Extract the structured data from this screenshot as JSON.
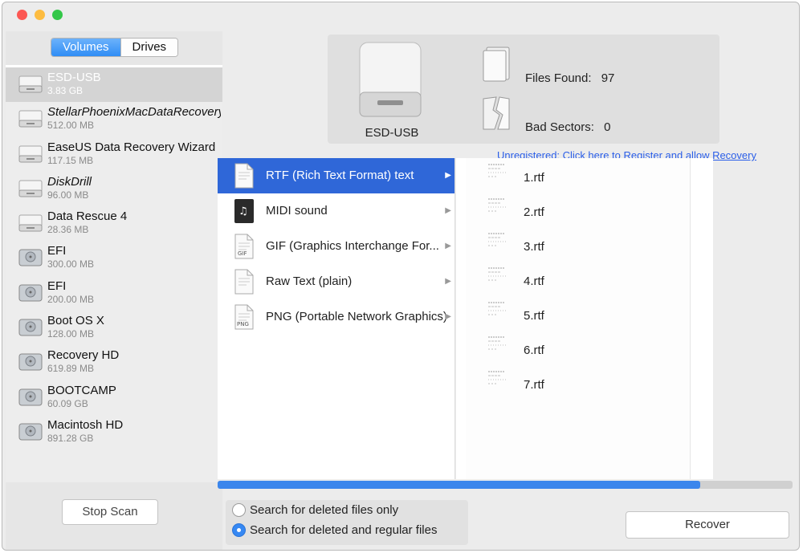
{
  "window": {
    "colors": {
      "close": "#fc5753",
      "minimize": "#fdbc40",
      "zoom": "#33c748",
      "accent": "#2f67d8",
      "link": "#2a5ee8"
    }
  },
  "sidebar": {
    "tabs": [
      {
        "label": "Volumes",
        "active": true
      },
      {
        "label": "Drives",
        "active": false
      }
    ],
    "volumes": [
      {
        "name": "ESD-USB",
        "size": "3.83 GB",
        "icon": "usb-drive-icon",
        "italic": false,
        "selected": true
      },
      {
        "name": "StellarPhoenixMacDataRecovery",
        "size": "512.00 MB",
        "icon": "disk-image-icon",
        "italic": true,
        "selected": false
      },
      {
        "name": "EaseUS Data Recovery Wizard",
        "size": "117.15 MB",
        "icon": "disk-image-icon",
        "italic": false,
        "selected": false
      },
      {
        "name": "DiskDrill",
        "size": "96.00 MB",
        "icon": "disk-image-icon",
        "italic": true,
        "selected": false
      },
      {
        "name": "Data Rescue 4",
        "size": "28.36 MB",
        "icon": "disk-image-icon",
        "italic": false,
        "selected": false
      },
      {
        "name": "EFI",
        "size": "300.00 MB",
        "icon": "hard-disk-icon",
        "italic": false,
        "selected": false
      },
      {
        "name": "EFI",
        "size": "200.00 MB",
        "icon": "hard-disk-icon",
        "italic": false,
        "selected": false
      },
      {
        "name": "Boot OS X",
        "size": "128.00 MB",
        "icon": "hard-disk-icon",
        "italic": false,
        "selected": false
      },
      {
        "name": "Recovery HD",
        "size": "619.89 MB",
        "icon": "hard-disk-icon",
        "italic": false,
        "selected": false
      },
      {
        "name": "BOOTCAMP",
        "size": "60.09 GB",
        "icon": "hard-disk-icon",
        "italic": false,
        "selected": false
      },
      {
        "name": "Macintosh HD",
        "size": "891.28 GB",
        "icon": "hard-disk-icon",
        "italic": false,
        "selected": false
      }
    ],
    "stop_scan_label": "Stop Scan"
  },
  "header": {
    "drive_label": "ESD-USB",
    "files_found_label": "Files Found:",
    "files_found_value": "97",
    "bad_sectors_label": "Bad Sectors:",
    "bad_sectors_value": "0",
    "register_link": "Unregistered: Click here to Register and allow Recovery"
  },
  "file_types": [
    {
      "label": "RTF (Rich Text Format) text",
      "icon": "rtf-file-icon",
      "selected": true
    },
    {
      "label": "MIDI sound",
      "icon": "midi-file-icon",
      "selected": false
    },
    {
      "label": "GIF (Graphics Interchange For...",
      "icon": "gif-file-icon",
      "selected": false
    },
    {
      "label": "Raw Text (plain)",
      "icon": "text-file-icon",
      "selected": false
    },
    {
      "label": "PNG (Portable Network Graphics)",
      "icon": "png-file-icon",
      "selected": false
    }
  ],
  "files": [
    "1.rtf",
    "2.rtf",
    "3.rtf",
    "4.rtf",
    "5.rtf",
    "6.rtf",
    "7.rtf"
  ],
  "progress": {
    "fraction": 0.84
  },
  "options": [
    {
      "label": "Search for deleted files only",
      "checked": false
    },
    {
      "label": "Search for deleted and regular files",
      "checked": true
    }
  ],
  "recover_label": "Recover"
}
